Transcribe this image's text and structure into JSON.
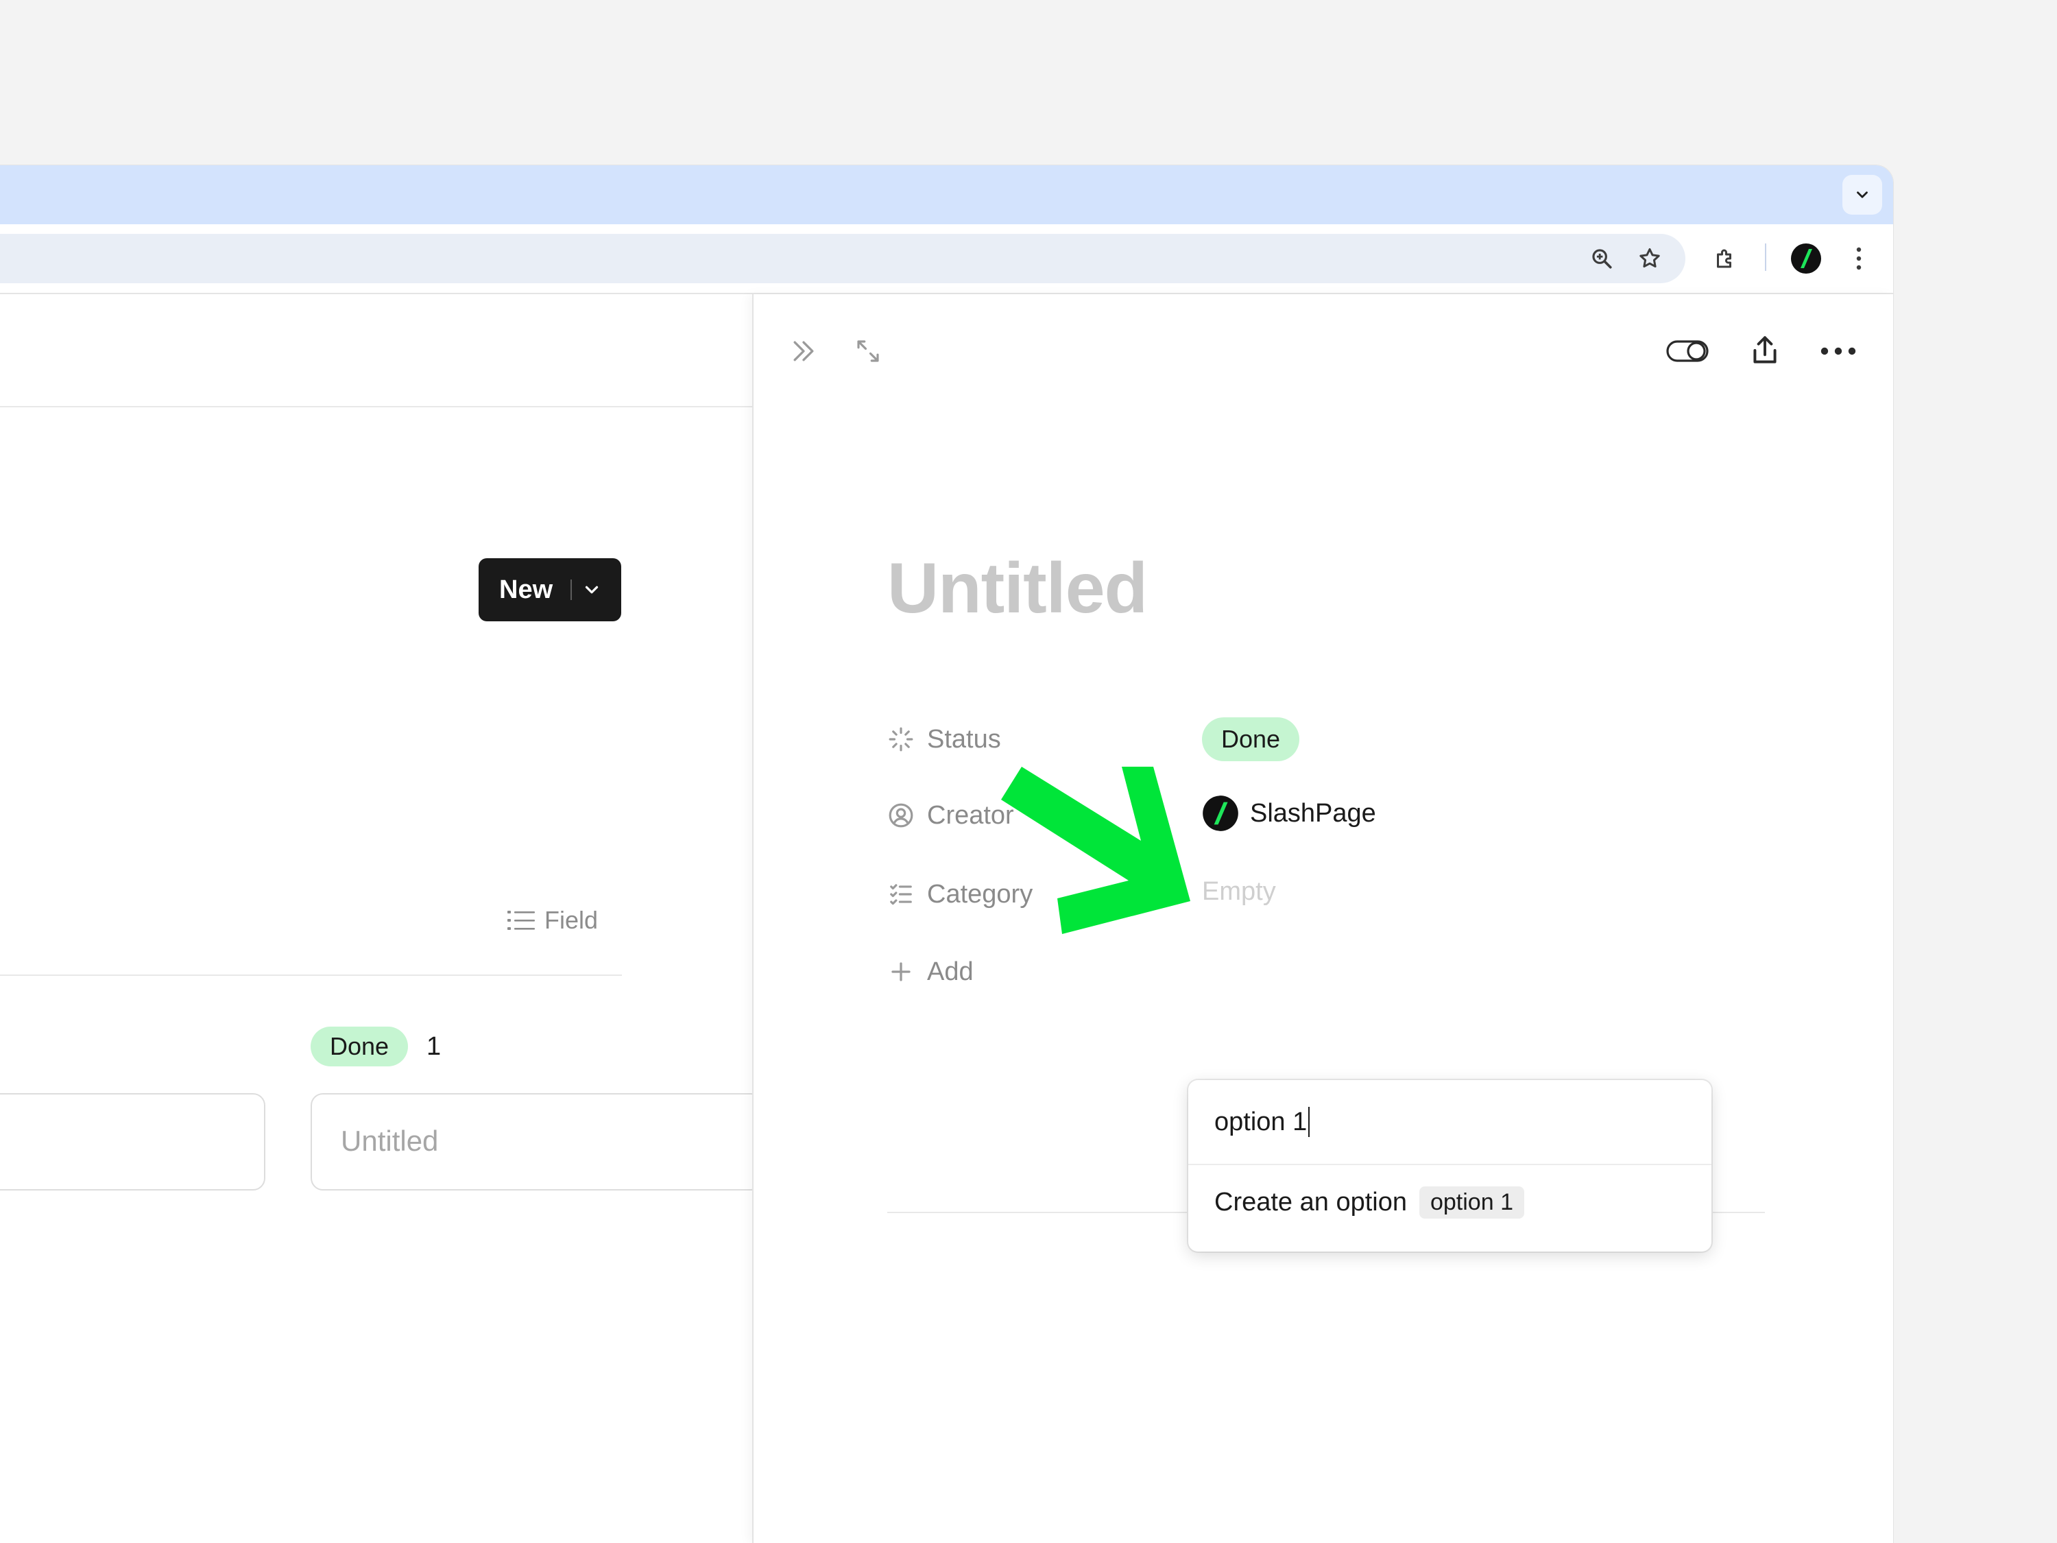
{
  "colors": {
    "tabstrip": "#d3e3fd",
    "omnibox": "#e9eef6",
    "tag_green": "#c5f5d1",
    "new_button": "#1a1a1a",
    "annotation_arrow": "#00e539"
  },
  "browser": {
    "icons": [
      "tab-search-chevron-icon",
      "zoom-icon",
      "bookmark-star-icon",
      "extensions-puzzle-icon",
      "slashpage-extension-icon",
      "browser-menu-icon"
    ]
  },
  "board": {
    "new_label": "New",
    "field_label": "Field",
    "group": {
      "label": "Done",
      "count": "1"
    },
    "card_title": "Untitled"
  },
  "panel": {
    "title": "Untitled",
    "properties": [
      {
        "label": "Status",
        "icon": "status-sparkle-icon"
      },
      {
        "label": "Creator",
        "icon": "person-circle-icon"
      },
      {
        "label": "Category",
        "icon": "checklist-icon"
      }
    ],
    "status_value": "Done",
    "creator_value": "SlashPage",
    "category_value": "Empty",
    "add_label": "Add"
  },
  "dropdown": {
    "input_value": "option 1",
    "create_label": "Create an option",
    "create_value": "option 1"
  }
}
